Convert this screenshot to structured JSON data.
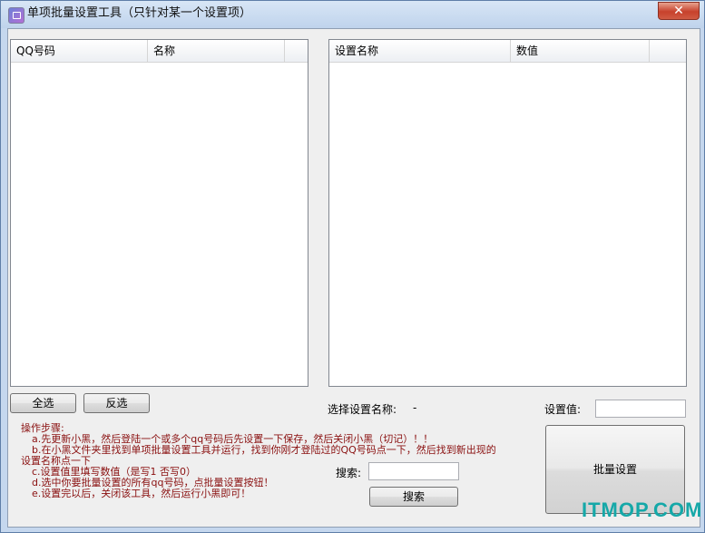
{
  "window": {
    "title": "单项批量设置工具（只针对某一个设置项）",
    "close_label": "✕"
  },
  "left_list": {
    "columns": [
      "QQ号码",
      "名称"
    ]
  },
  "right_list": {
    "columns": [
      "设置名称",
      "数值"
    ]
  },
  "buttons": {
    "select_all": "全选",
    "invert": "反选",
    "search": "搜索",
    "batch_set": "批量设置"
  },
  "labels": {
    "selected_setting": "选择设置名称:",
    "selected_setting_value": "-",
    "setting_value": "设置值:",
    "search": "搜索:"
  },
  "steps": {
    "heading": "操作步骤:",
    "a": "a.先更新小黑，然后登陆一个或多个qq号码后先设置一下保存，然后关闭小黑（切记）！！",
    "b1": "b.在小黑文件夹里找到单项批量设置工具并运行，找到你刚才登陆过的QQ号码点一下，然后找到新出现的",
    "b2": "设置名称点一下",
    "c": "c.设置值里填写数值（是写1 否写0）",
    "d": "d.选中你要批量设置的所有qq号码，点批量设置按钮！",
    "e": "e.设置完以后，关闭该工具，然后运行小黑即可！"
  },
  "watermark": "ITMOP.COM",
  "colors": {
    "titlebar": "#c5d7ee",
    "steps_text": "#8a1010",
    "close_button": "#c7412c",
    "watermark": "#15a8a8"
  }
}
